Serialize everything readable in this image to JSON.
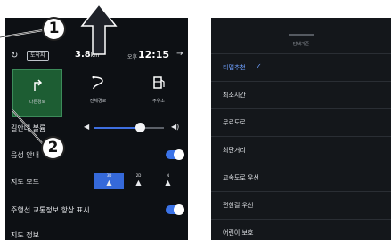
{
  "status_bar": {
    "refresh_icon": "refresh-icon",
    "destination_badge": "도착지",
    "distance": "3.8",
    "distance_unit": "km",
    "ampm": "오후",
    "time": "12:15",
    "exit_icon": "exit-icon"
  },
  "route_options": [
    {
      "label": "다른경로",
      "icon": "route-turn-icon",
      "selected": true
    },
    {
      "label": "전체경로",
      "icon": "route-overview-icon",
      "selected": false
    },
    {
      "label": "주유소",
      "icon": "gas-station-icon",
      "selected": false
    }
  ],
  "settings": {
    "guidance_volume": {
      "label": "길안내 볼륨",
      "level_percent": 68
    },
    "voice_guidance": {
      "label": "음성 안내",
      "on": true
    },
    "map_mode": {
      "label": "지도 모드",
      "options": [
        "3D",
        "2D",
        "N"
      ],
      "selected_index": 0
    },
    "traffic_info": {
      "label": "주행선 교통정보 항상 표시",
      "on": true
    },
    "map_info": {
      "label": "지도 정보"
    }
  },
  "callouts": [
    "1",
    "2"
  ],
  "route_menu": {
    "header": "탐색기준",
    "items": [
      {
        "label": "티맵추천",
        "selected": true
      },
      {
        "label": "최소시간",
        "selected": false
      },
      {
        "label": "무료도로",
        "selected": false
      },
      {
        "label": "최단거리",
        "selected": false
      },
      {
        "label": "고속도로 우선",
        "selected": false
      },
      {
        "label": "편한길 우선",
        "selected": false
      },
      {
        "label": "어린이 보호",
        "selected": false
      }
    ]
  },
  "colors": {
    "selected_route_bg": "#1d5d33",
    "accent_blue": "#3b73e8",
    "selected_text": "#6ea0ff"
  }
}
